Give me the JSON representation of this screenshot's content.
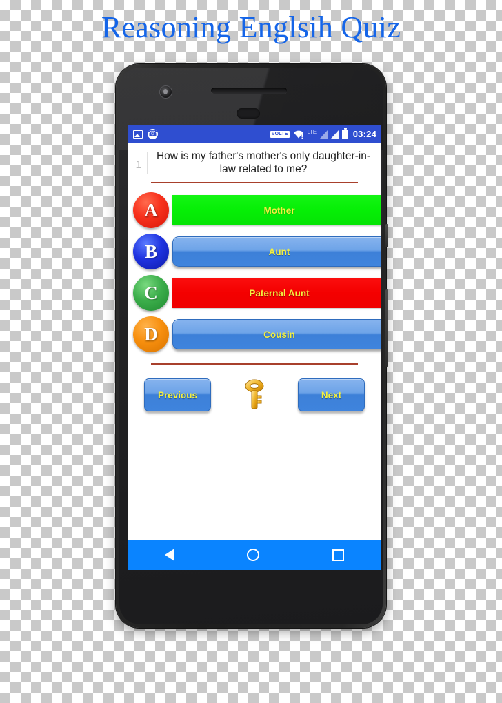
{
  "page": {
    "title": "Reasoning Englsih Quiz"
  },
  "device": {
    "status_bar": {
      "left_icons": [
        "image-icon",
        "phone-icon"
      ],
      "volte_label": "VOLTE",
      "lte_label": "LTE",
      "right_icons": [
        "wifi-icon",
        "signal-icon",
        "signal-icon",
        "battery-icon"
      ],
      "clock": "03:24"
    },
    "nav_bar": {
      "back_label": "back-icon",
      "home_label": "home-icon",
      "recents_label": "recents-icon"
    }
  },
  "quiz": {
    "question_number": "1",
    "question_text": "How is my father's mother's only daughter-in-law related to me?",
    "options": [
      {
        "letter": "A",
        "text": "Mother",
        "circle_color": "#f8321d",
        "button_color": "#06ef06",
        "state": "correct"
      },
      {
        "letter": "B",
        "text": "Aunt",
        "circle_color": "#1f33e0",
        "button_color": "#3f84dd",
        "state": "default"
      },
      {
        "letter": "C",
        "text": "Paternal Aunt",
        "circle_color": "#3cae4b",
        "button_color": "#f40000",
        "state": "wrong"
      },
      {
        "letter": "D",
        "text": "Cousin",
        "circle_color": "#f78f0e",
        "button_color": "#3f84dd",
        "state": "default"
      }
    ],
    "previous_label": "Previous",
    "next_label": "Next",
    "key_icon": "key-icon"
  },
  "colors": {
    "title": "#1565e8",
    "status_bar": "#2f4ed0",
    "nav_bar": "#0a84ff",
    "rule": "#a8402c",
    "answer_text": "#f4f040"
  }
}
